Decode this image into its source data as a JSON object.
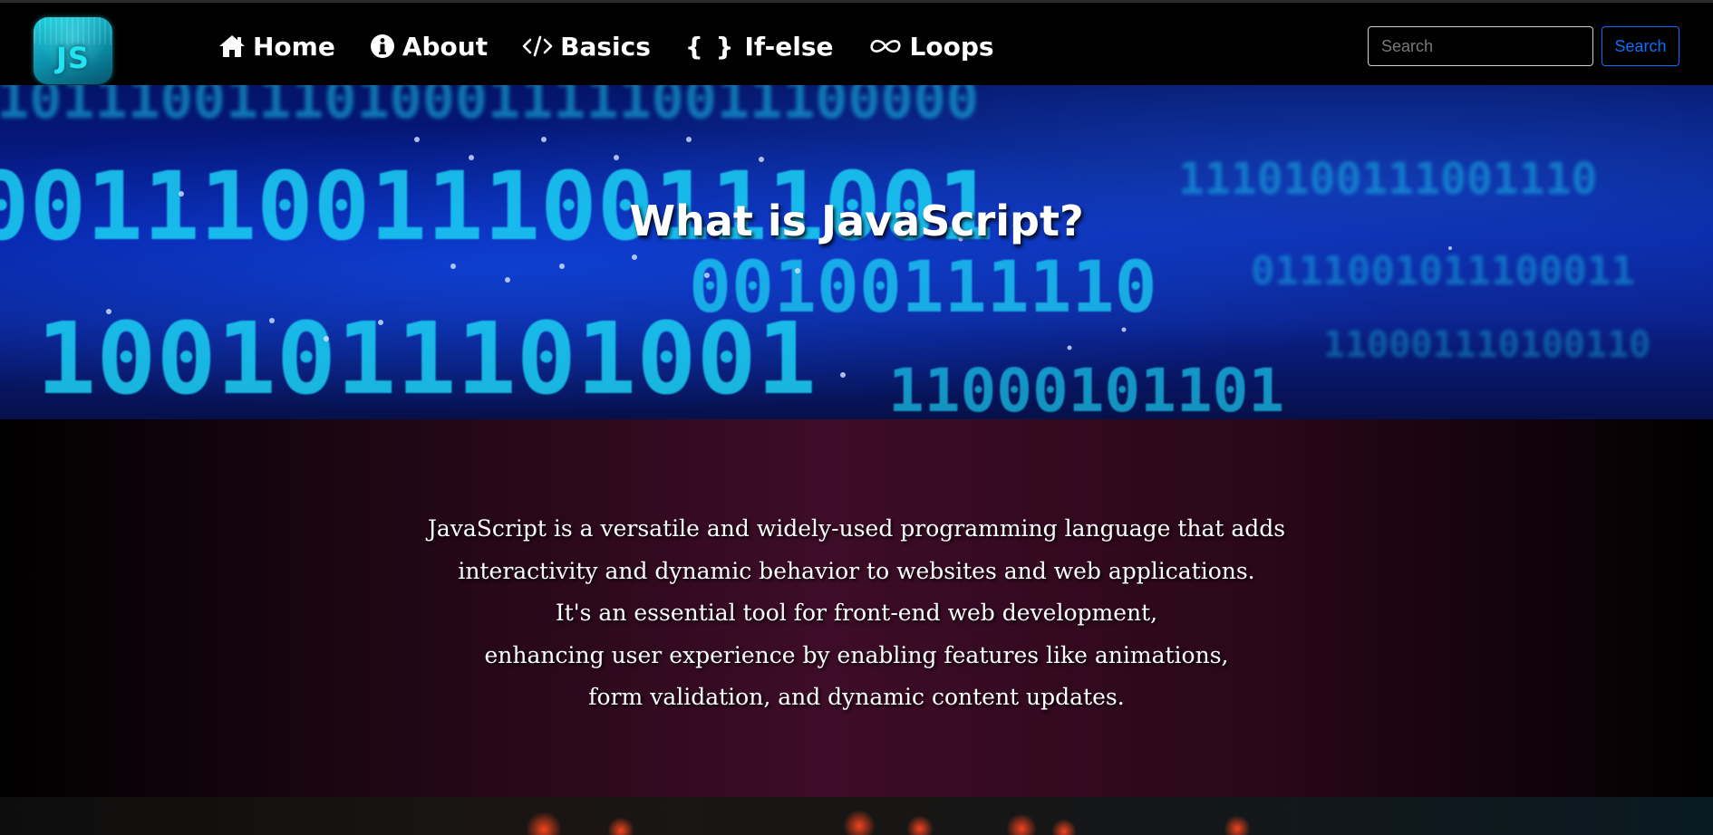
{
  "logo": {
    "text": "JS",
    "color": "#22e4f0"
  },
  "nav": {
    "items": [
      {
        "label": "Home",
        "icon": "house-icon"
      },
      {
        "label": "About",
        "icon": "info-circle-icon"
      },
      {
        "label": "Basics",
        "icon": "code-slash-icon"
      },
      {
        "label": "If-else",
        "icon": "braces-icon",
        "icon_text": "{ }"
      },
      {
        "label": "Loops",
        "icon": "infinity-icon"
      }
    ]
  },
  "search": {
    "placeholder": "Search",
    "value": "",
    "button_label": "Search",
    "button_color": "#0d6efd"
  },
  "hero": {
    "title": "What is JavaScript?"
  },
  "about": {
    "lines": [
      "JavaScript is a versatile and widely-used programming language that adds",
      "interactivity and dynamic behavior to websites and web applications.",
      "It's an essential tool for front-end web development,",
      "enhancing user experience by enabling features like animations,",
      "form validation, and dynamic content updates."
    ]
  }
}
